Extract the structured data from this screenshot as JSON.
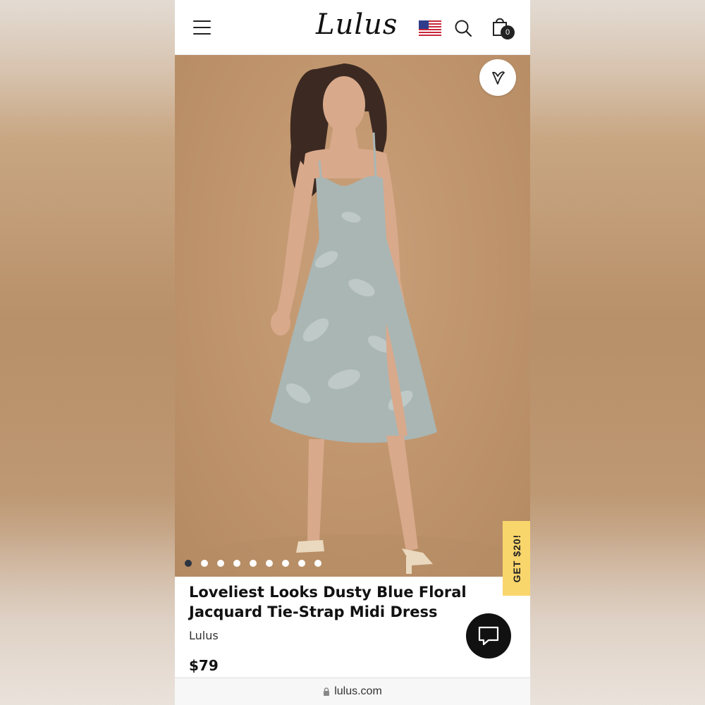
{
  "header": {
    "logo_text": "Lulus",
    "cart_count": "0",
    "icons": [
      "menu-icon",
      "us-flag-icon",
      "search-icon",
      "shopping-bag-icon"
    ]
  },
  "hero": {
    "carousel_total": 9,
    "carousel_active": 1,
    "favorite_icon": "heart-icon"
  },
  "promo_tab": {
    "label": "GET $20!"
  },
  "product": {
    "title": "Loveliest Looks Dusty Blue Floral Jacquard Tie-Strap Midi Dress",
    "brand": "Lulus",
    "price": "$79"
  },
  "chat": {
    "icon": "chat-bubble-icon"
  },
  "browser": {
    "url": "lulus.com",
    "lock_icon": "lock-icon"
  },
  "colors": {
    "background": "#bf946c",
    "promo": "#f9d66b",
    "dress": "#a9b6b4",
    "dark": "#111111"
  }
}
